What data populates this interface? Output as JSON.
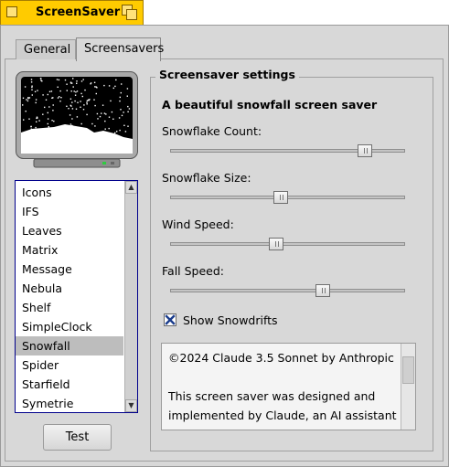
{
  "window": {
    "title": "ScreenSaver",
    "tabs": [
      {
        "label": "General",
        "active": false
      },
      {
        "label": "Screensavers",
        "active": true
      }
    ]
  },
  "screensaver_list": {
    "items": [
      "Icons",
      "IFS",
      "Leaves",
      "Matrix",
      "Message",
      "Nebula",
      "Shelf",
      "SimpleClock",
      "Snowfall",
      "Spider",
      "Starfield",
      "Symetrie"
    ],
    "selected": "Snowfall"
  },
  "test_button": {
    "label": "Test"
  },
  "settings": {
    "group_title": "Screensaver settings",
    "heading": "A beautiful snowfall screen saver",
    "sliders": [
      {
        "label": "Snowflake Count:",
        "level": 0.83
      },
      {
        "label": "Snowflake Size:",
        "level": 0.47
      },
      {
        "label": "Wind Speed:",
        "level": 0.45
      },
      {
        "label": "Fall Speed:",
        "level": 0.65
      }
    ],
    "show_snowdrifts": {
      "label": "Show Snowdrifts",
      "checked": true
    },
    "about_text": "©2024 Claude 3.5 Sonnet by Anthropic\n\nThis screen saver was designed and implemented by Claude, an AI assistant created by Anthropic, demonstrating the"
  },
  "colors": {
    "title_tab": "#ffcb00",
    "window_bg": "#d8d8d8",
    "list_border": "#00008b",
    "selected_row": "#bdbdbd",
    "checkbox_mark": "#1a3c8c"
  }
}
